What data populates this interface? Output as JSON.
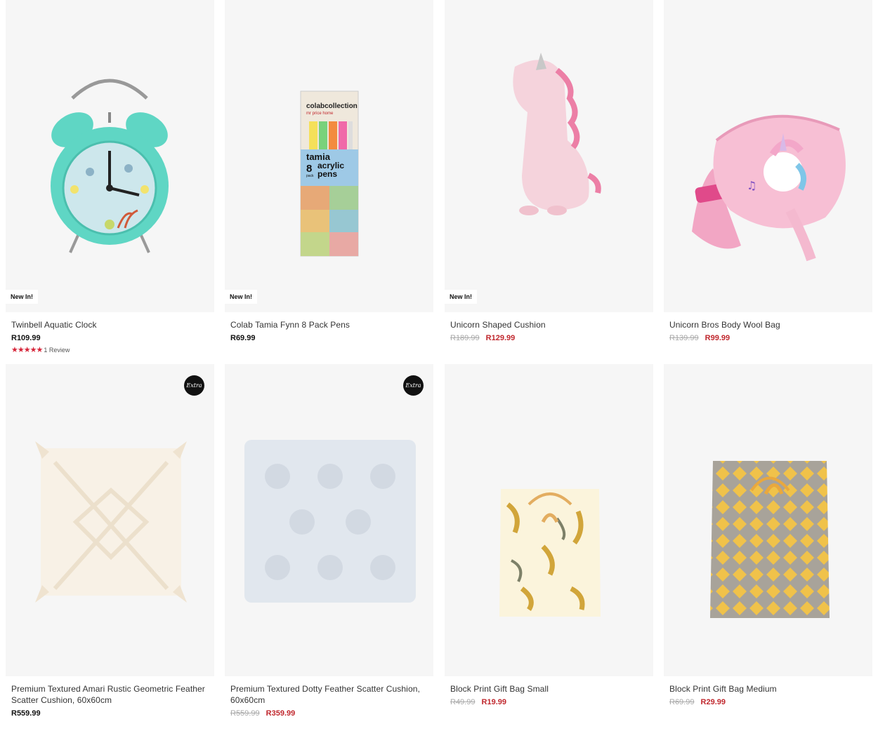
{
  "products": [
    {
      "name": "Twinbell Aquatic Clock",
      "badge": "New In!",
      "price": "R109.99",
      "rating_stars": 5,
      "reviews": "1 Review",
      "image": "alarm-clock-image"
    },
    {
      "name": "Colab Tamia Fynn 8 Pack Pens",
      "badge": "New In!",
      "price": "R69.99",
      "image": "acrylic-pens-image",
      "pack_text": {
        "brand": "colabcollection",
        "sub": "mr price home",
        "name": "tamia",
        "count": "8",
        "type1": "acrylic",
        "type2": "pens",
        "pack": "pack"
      }
    },
    {
      "name": "Unicorn Shaped Cushion",
      "badge": "New In!",
      "old_price": "R189.99",
      "sale_price": "R129.99",
      "image": "unicorn-cushion-image"
    },
    {
      "name": "Unicorn Bros Body Wool Bag",
      "old_price": "R139.99",
      "sale_price": "R99.99",
      "image": "unicorn-bag-image"
    },
    {
      "name": "Premium Textured Amari Rustic Geometric Feather Scatter Cushion, 60x60cm",
      "price": "R559.99",
      "extra_badge": "Extra",
      "image": "white-cushion-image"
    },
    {
      "name": "Premium Textured Dotty Feather Scatter Cushion, 60x60cm",
      "old_price": "R559.99",
      "sale_price": "R359.99",
      "extra_badge": "Extra",
      "image": "blue-cushion-image"
    },
    {
      "name": "Block Print Gift Bag Small",
      "old_price": "R49.99",
      "sale_price": "R19.99",
      "image": "gift-bag-small-image"
    },
    {
      "name": "Block Print Gift Bag Medium",
      "old_price": "R69.99",
      "sale_price": "R29.99",
      "image": "gift-bag-medium-image"
    }
  ],
  "colors": {
    "sale": "#c0272d",
    "image_bg": "#f6f6f6",
    "star": "#d6263a"
  }
}
